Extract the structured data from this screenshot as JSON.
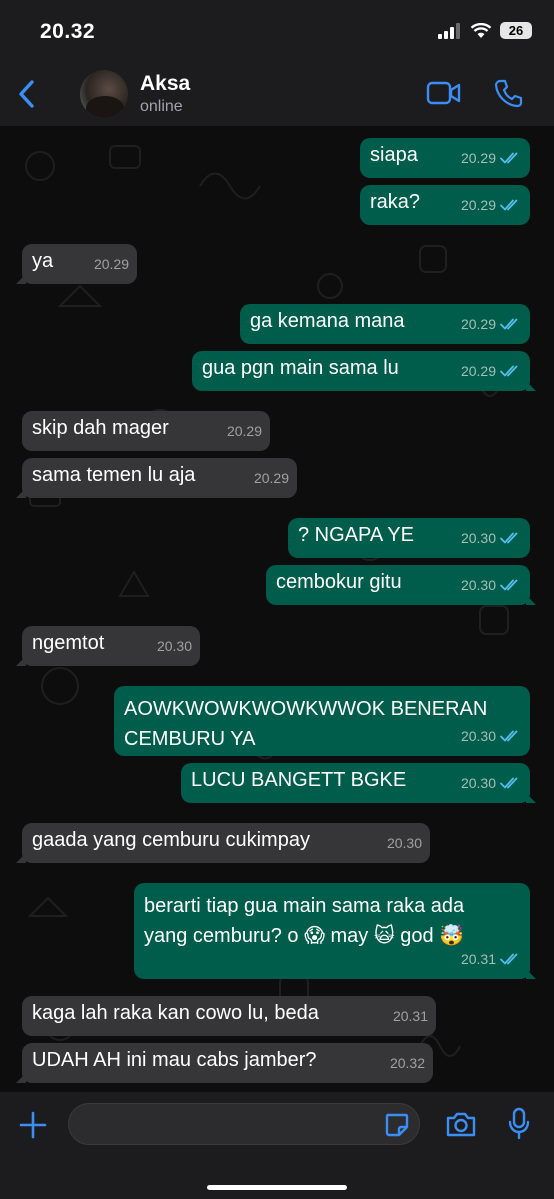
{
  "status_bar": {
    "time": "20.32",
    "battery": "26"
  },
  "header": {
    "contact_name": "Aksa",
    "contact_status": "online"
  },
  "messages": [
    {
      "text": "siapa",
      "time": "20.29",
      "direction": "out"
    },
    {
      "text": "raka?",
      "time": "20.29",
      "direction": "out"
    },
    {
      "text": "ya",
      "time": "20.29",
      "direction": "in"
    },
    {
      "text": "ga kemana mana",
      "time": "20.29",
      "direction": "out"
    },
    {
      "text": "gua pgn main sama lu",
      "time": "20.29",
      "direction": "out"
    },
    {
      "text": "skip dah mager",
      "time": "20.29",
      "direction": "in"
    },
    {
      "text": "sama temen lu aja",
      "time": "20.29",
      "direction": "in"
    },
    {
      "text": "? NGAPA YE",
      "time": "20.30",
      "direction": "out"
    },
    {
      "text": "cembokur gitu",
      "time": "20.30",
      "direction": "out"
    },
    {
      "text": "ngemtot",
      "time": "20.30",
      "direction": "in"
    },
    {
      "text": "AOWKWOWKWOWKWWOK BENERAN CEMBURU YA",
      "time": "20.30",
      "direction": "out"
    },
    {
      "text": "LUCU BANGETT BGKE",
      "time": "20.30",
      "direction": "out"
    },
    {
      "text": "gaada yang cemburu cukimpay",
      "time": "20.30",
      "direction": "in"
    },
    {
      "text": "berarti tiap gua main sama raka ada yang cemburu? o 😱 may 🙀 god 🤯",
      "time": "20.31",
      "direction": "out"
    },
    {
      "text": "kaga lah raka kan cowo lu, beda",
      "time": "20.31",
      "direction": "in"
    },
    {
      "text": "UDAH AH ini mau cabs jamber?",
      "time": "20.32",
      "direction": "in"
    }
  ],
  "input": {
    "placeholder": ""
  },
  "colors": {
    "accent": "#3b8ef5",
    "outgoing_bubble": "#005c4b",
    "incoming_bubble": "#363638",
    "read_tick": "#53bdeb"
  },
  "icons": [
    "back-chevron-icon",
    "video-call-icon",
    "phone-icon",
    "plus-icon",
    "sticker-icon",
    "camera-icon",
    "mic-icon",
    "double-check-icon"
  ]
}
